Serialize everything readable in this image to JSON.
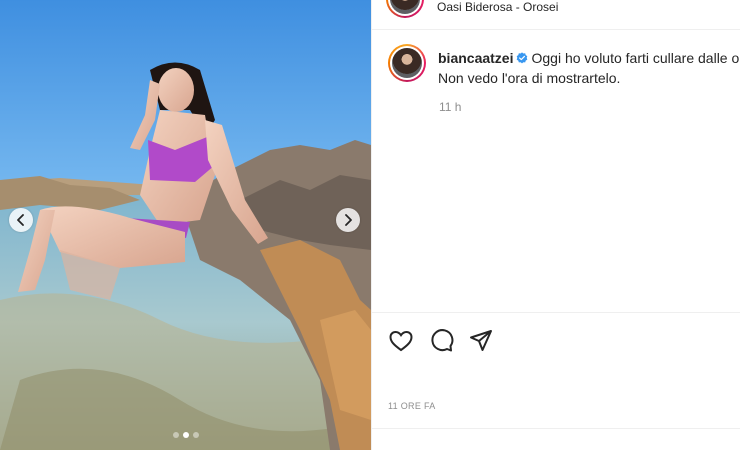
{
  "post": {
    "location": "Oasi Biderosa - Orosei",
    "username": "biancaatzei",
    "caption_line1": "Oggi ho voluto farti cullare dalle o",
    "caption_line2": "Non vedo l'ora di mostrartelo.",
    "caption_time": "11 h",
    "timestamp": "11 ORE FA"
  },
  "media": {
    "slide_count": 3,
    "active_slide": 2
  },
  "icons": {
    "like": "heart-icon",
    "comment": "comment-icon",
    "share": "share-icon",
    "verified": "verified-badge-icon",
    "prev": "chevron-left-icon",
    "next": "chevron-right-icon"
  },
  "colors": {
    "verified_blue": "#3897f0",
    "text": "#262626",
    "muted": "#8e8e8e"
  }
}
